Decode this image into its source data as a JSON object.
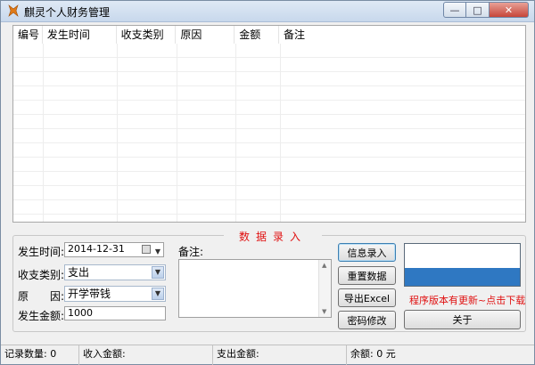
{
  "window": {
    "title": "麒灵个人财务管理"
  },
  "table": {
    "columns": [
      "编号",
      "发生时间",
      "收支类别",
      "原因",
      "金额",
      "备注"
    ],
    "rows": []
  },
  "form": {
    "group_title": "数据录入",
    "date_label": "发生时间:",
    "date_value": "2014-12-31",
    "category_label": "收支类别:",
    "category_value": "支出",
    "reason_label": "原　　因:",
    "reason_value": "开学带钱",
    "amount_label": "发生金额:",
    "amount_value": "1000",
    "memo_label": "备注:",
    "memo_value": ""
  },
  "buttons": {
    "info_entry": "信息录入",
    "reset": "重置数据",
    "export": "导出Excel",
    "change_password": "密码修改",
    "about": "关于"
  },
  "update_notice": "程序版本有更新~点击下载",
  "status": {
    "records": "记录数量: 0",
    "income": "收入金额:",
    "expense": "支出金额:",
    "balance": "余额: 0 元"
  },
  "colors": {
    "accent_red": "#e01010",
    "promo_blue": "#2f78c2"
  }
}
